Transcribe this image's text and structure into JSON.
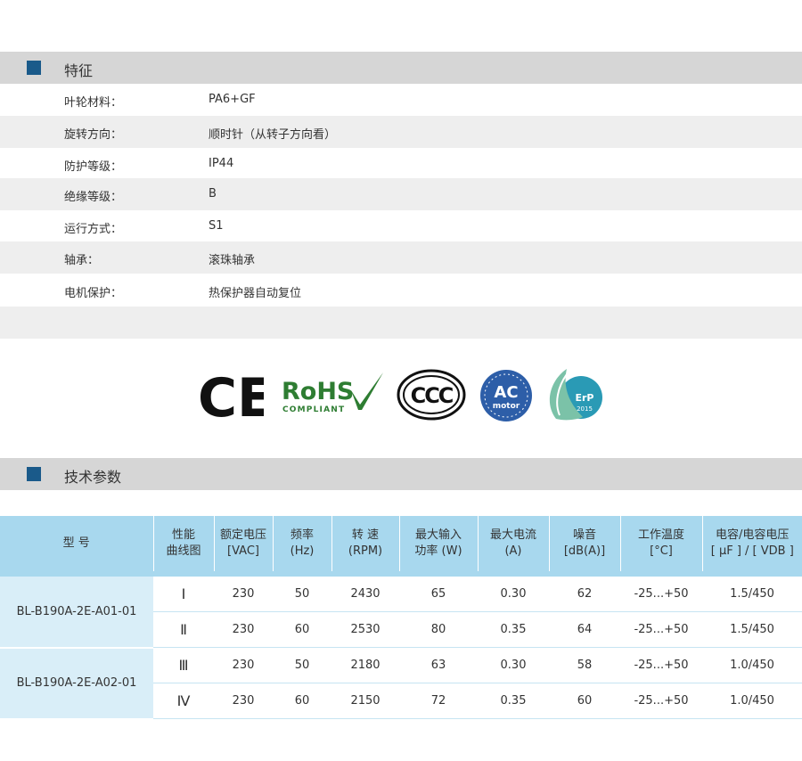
{
  "features": {
    "title": "特征",
    "rows": [
      {
        "label": "叶轮材料：",
        "value": "PA6+GF"
      },
      {
        "label": "旋转方向：",
        "value": "顺时针（从转子方向看）"
      },
      {
        "label": "防护等级：",
        "value": "IP44"
      },
      {
        "label": "绝缘等级：",
        "value": "B"
      },
      {
        "label": "运行方式：",
        "value": "S1"
      },
      {
        "label": "轴承：",
        "value": "滚珠轴承"
      },
      {
        "label": "电机保护：",
        "value": "热保护器自动复位"
      }
    ]
  },
  "certifications": {
    "ce": "CE",
    "rohs": "RoHS",
    "rohs_sub": "COMPLIANT",
    "ccc": "CCC",
    "ac": "AC",
    "ac_sub": "motor",
    "erp": "ErP",
    "erp_year": "2015"
  },
  "specs": {
    "title": "技术参数",
    "headers": [
      {
        "l1": "型 号",
        "l2": ""
      },
      {
        "l1": "性能",
        "l2": "曲线图"
      },
      {
        "l1": "额定电压",
        "l2": "[VAC]"
      },
      {
        "l1": "频率",
        "l2": "(Hz)"
      },
      {
        "l1": "转 速",
        "l2": "(RPM)"
      },
      {
        "l1": "最大输入",
        "l2": "功率 (W)"
      },
      {
        "l1": "最大电流",
        "l2": "(A)"
      },
      {
        "l1": "噪音",
        "l2": "[dB(A)]"
      },
      {
        "l1": "工作温度",
        "l2": "[°C]"
      },
      {
        "l1": "电容/电容电压",
        "l2": "[ μF ] / [ VDB ]"
      }
    ],
    "groups": [
      {
        "model": "BL-B190A-2E-A01-01",
        "rows": [
          {
            "curve": "Ⅰ",
            "voltage": "230",
            "freq": "50",
            "rpm": "2430",
            "power": "65",
            "current": "0.30",
            "noise": "62",
            "temp": "-25...+50",
            "cap": "1.5/450"
          },
          {
            "curve": "Ⅱ",
            "voltage": "230",
            "freq": "60",
            "rpm": "2530",
            "power": "80",
            "current": "0.35",
            "noise": "64",
            "temp": "-25...+50",
            "cap": "1.5/450"
          }
        ]
      },
      {
        "model": "BL-B190A-2E-A02-01",
        "rows": [
          {
            "curve": "Ⅲ",
            "voltage": "230",
            "freq": "50",
            "rpm": "2180",
            "power": "63",
            "current": "0.30",
            "noise": "58",
            "temp": "-25...+50",
            "cap": "1.0/450"
          },
          {
            "curve": "Ⅳ",
            "voltage": "230",
            "freq": "60",
            "rpm": "2150",
            "power": "72",
            "current": "0.35",
            "noise": "60",
            "temp": "-25...+50",
            "cap": "1.0/450"
          }
        ]
      }
    ]
  }
}
